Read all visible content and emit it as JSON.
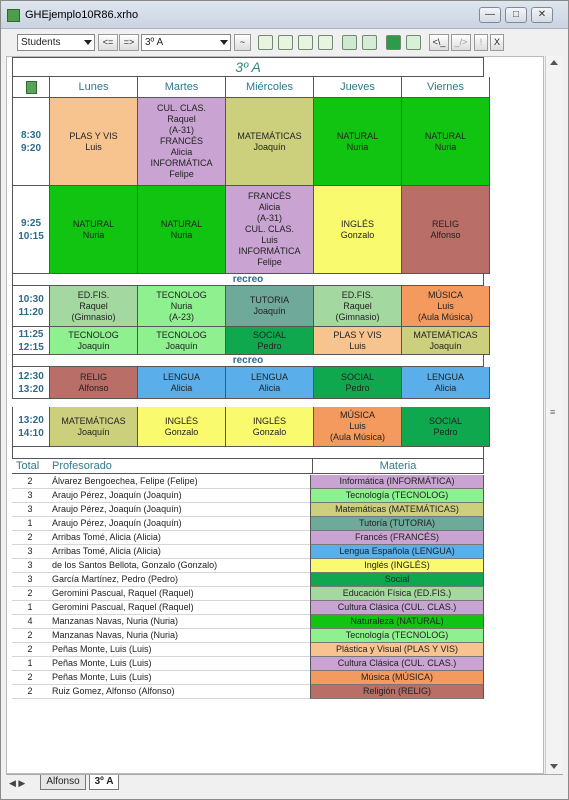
{
  "window": {
    "title": "GHEjemplo10R86.xrho"
  },
  "toolbar": {
    "view_select": "Students",
    "prev_label": "<=",
    "next_label": "=>",
    "group_select": "3º A",
    "tilde_label": "~",
    "back_label": "<\\_",
    "fwd_label": "_/>",
    "excl_label": "!",
    "close_label": "X"
  },
  "schedule": {
    "title": "3º A",
    "days": [
      "Lunes",
      "Martes",
      "Miércoles",
      "Jueves",
      "Viernes"
    ],
    "recreo_label": "recreo",
    "times": [
      "8:30\n9:20",
      "9:25\n10:15",
      "10:30\n11:20",
      "11:25\n12:15",
      "12:30\n13:20",
      "13:20\n14:10"
    ],
    "rows": [
      [
        {
          "text": "PLAS Y VIS\nLuis",
          "color": "#f7c38f"
        },
        {
          "text": "CUL. CLAS.\nRaquel\n(A-31)\nFRANCÉS\nAlicia\nINFORMÁTICA\nFelipe",
          "color": "#c9a3d2"
        },
        {
          "text": "MATEMÁTICAS\nJoaquín",
          "color": "#cccf7c"
        },
        {
          "text": "NATURAL\nNuria",
          "color": "#12c412"
        },
        {
          "text": "NATURAL\nNuria",
          "color": "#12c412"
        }
      ],
      [
        {
          "text": "NATURAL\nNuria",
          "color": "#12c412"
        },
        {
          "text": "NATURAL\nNuria",
          "color": "#12c412"
        },
        {
          "text": "FRANCÉS\nAlicia\n(A-31)\nCUL. CLAS.\nLuis\nINFORMÁTICA\nFelipe",
          "color": "#c9a3d2"
        },
        {
          "text": "INGLÉS\nGonzalo",
          "color": "#fafa6e"
        },
        {
          "text": "RELIG\nAlfonso",
          "color": "#b96e67"
        }
      ],
      [
        {
          "text": "ED.FIS.\nRaquel\n(Gimnasio)",
          "color": "#a3d9a0"
        },
        {
          "text": "TECNOLOG\nNuria\n(A-23)",
          "color": "#8ef08e"
        },
        {
          "text": "TUTORIA\nJoaquín",
          "color": "#6fa99a"
        },
        {
          "text": "ED.FIS.\nRaquel\n(Gimnasio)",
          "color": "#a3d9a0"
        },
        {
          "text": "MÚSICA\nLuis\n(Aula Música)",
          "color": "#f49a5e"
        }
      ],
      [
        {
          "text": "TECNOLOG\nJoaquín",
          "color": "#8ef08e"
        },
        {
          "text": "TECNOLOG\nJoaquín",
          "color": "#8ef08e"
        },
        {
          "text": "SOCIAL\nPedro",
          "color": "#10a84e"
        },
        {
          "text": "PLAS Y VIS\nLuis",
          "color": "#f7c38f"
        },
        {
          "text": "MATEMÁTICAS\nJoaquín",
          "color": "#cccf7c"
        }
      ],
      [
        {
          "text": "RELIG\nAlfonso",
          "color": "#b96e67"
        },
        {
          "text": "LENGUA\nAlicia",
          "color": "#5aaeea"
        },
        {
          "text": "LENGUA\nAlicia",
          "color": "#5aaeea"
        },
        {
          "text": "SOCIAL\nPedro",
          "color": "#10a84e"
        },
        {
          "text": "LENGUA\nAlicia",
          "color": "#5aaeea"
        }
      ],
      [
        {
          "text": "MATEMÁTICAS\nJoaquín",
          "color": "#cccf7c"
        },
        {
          "text": "INGLÉS\nGonzalo",
          "color": "#fafa6e"
        },
        {
          "text": "INGLÉS\nGonzalo",
          "color": "#fafa6e"
        },
        {
          "text": "MÚSICA\nLuis\n(Aula Música)",
          "color": "#f49a5e"
        },
        {
          "text": "SOCIAL\nPedro",
          "color": "#10a84e"
        }
      ]
    ]
  },
  "summary": {
    "headers": {
      "total": "Total",
      "profesorado": "Profesorado",
      "materia": "Materia"
    },
    "rows": [
      {
        "total": "2",
        "prof": "Álvarez Bengoechea, Felipe (Felipe)",
        "materia": "Informática (INFORMÁTICA)",
        "color": "#c9a3d2"
      },
      {
        "total": "3",
        "prof": "Araujo Pérez, Joaquín (Joaquín)",
        "materia": "Tecnología (TECNOLOG)",
        "color": "#8ef08e"
      },
      {
        "total": "3",
        "prof": "Araujo Pérez, Joaquín (Joaquín)",
        "materia": "Matemáticas (MATEMÁTICAS)",
        "color": "#cccf7c"
      },
      {
        "total": "1",
        "prof": "Araujo Pérez, Joaquín (Joaquín)",
        "materia": "Tutoría (TUTORIA)",
        "color": "#6fa99a"
      },
      {
        "total": "2",
        "prof": "Arribas Tomé, Alicia (Alicia)",
        "materia": "Francés (FRANCÉS)",
        "color": "#c9a3d2"
      },
      {
        "total": "3",
        "prof": "Arribas Tomé, Alicia (Alicia)",
        "materia": "Lengua Española (LENGUA)",
        "color": "#5aaeea"
      },
      {
        "total": "3",
        "prof": "de los Santos Bellota, Gonzalo (Gonzalo)",
        "materia": "Inglés (INGLÉS)",
        "color": "#fafa6e"
      },
      {
        "total": "3",
        "prof": "García Martínez, Pedro (Pedro)",
        "materia": "Social",
        "color": "#10a84e"
      },
      {
        "total": "2",
        "prof": "Geromini Pascual, Raquel (Raquel)",
        "materia": "Educación Física (ED.FIS.)",
        "color": "#a3d9a0"
      },
      {
        "total": "1",
        "prof": "Geromini Pascual, Raquel (Raquel)",
        "materia": "Cultura Clásica (CUL. CLAS.)",
        "color": "#c9a3d2"
      },
      {
        "total": "4",
        "prof": "Manzanas Navas, Nuria (Nuria)",
        "materia": "Naturaleza (NATURAL)",
        "color": "#12c412"
      },
      {
        "total": "2",
        "prof": "Manzanas Navas, Nuria (Nuria)",
        "materia": "Tecnología (TECNOLOG)",
        "color": "#8ef08e"
      },
      {
        "total": "2",
        "prof": "Peñas Monte, Luis (Luis)",
        "materia": "Plástica y Visual (PLAS Y VIS)",
        "color": "#f7c38f"
      },
      {
        "total": "1",
        "prof": "Peñas Monte, Luis (Luis)",
        "materia": "Cultura Clásica (CUL. CLAS.)",
        "color": "#c9a3d2"
      },
      {
        "total": "2",
        "prof": "Peñas Monte, Luis (Luis)",
        "materia": "Música (MÚSICA)",
        "color": "#f49a5e"
      },
      {
        "total": "2",
        "prof": "Ruiz Gomez, Alfonso (Alfonso)",
        "materia": "Religión (RELIG)",
        "color": "#b96e67"
      }
    ]
  },
  "tabs": [
    {
      "label": "Alfonso",
      "active": false
    },
    {
      "label": "3º A",
      "active": true
    }
  ]
}
